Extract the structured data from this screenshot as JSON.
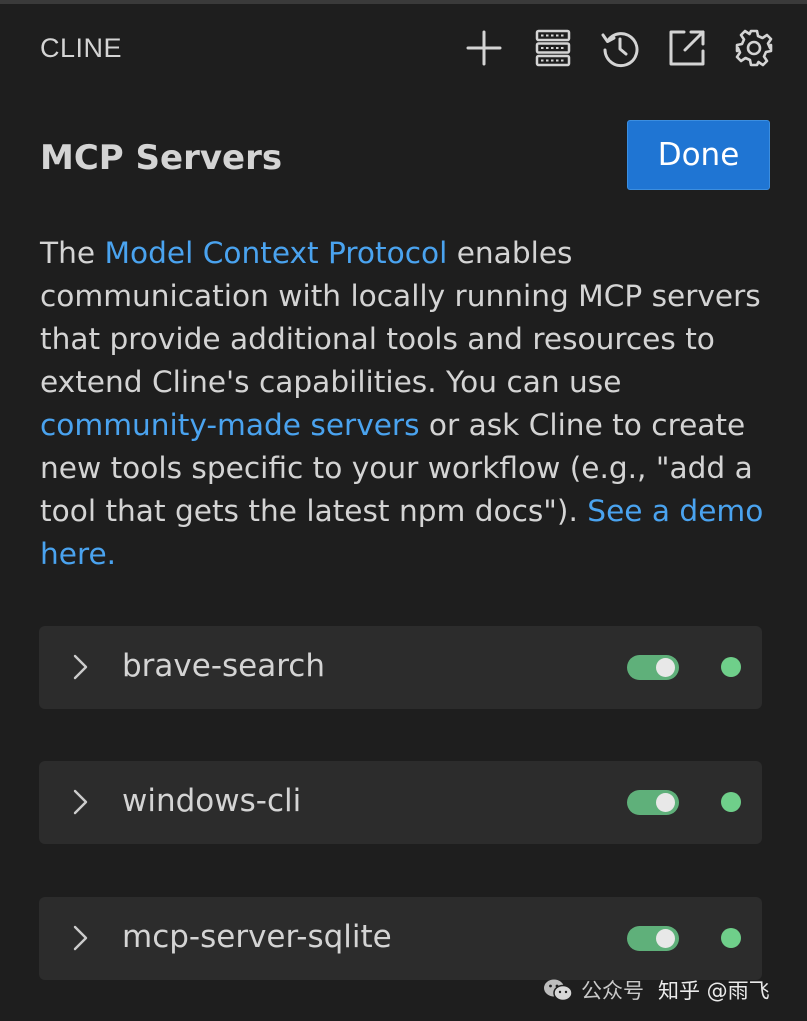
{
  "app": {
    "title": "CLINE"
  },
  "toolbar": {
    "icons": [
      "plus-icon",
      "mcp-servers-icon",
      "history-icon",
      "open-external-icon",
      "gear-icon"
    ]
  },
  "header": {
    "title": "MCP Servers",
    "done_label": "Done"
  },
  "description": {
    "p1": "The ",
    "link1": "Model Context Protocol",
    "p2": " enables communication with locally running MCP servers that provide additional tools and resources to extend Cline's capabilities. You can use ",
    "link2": "community-made servers",
    "p3": " or ask Cline to create new tools specific to your workflow (e.g., \"add a tool that gets the latest npm docs\"). ",
    "link3": "See a demo here."
  },
  "servers": [
    {
      "name": "brave-search",
      "enabled": true,
      "status": "connected"
    },
    {
      "name": "windows-cli",
      "enabled": true,
      "status": "connected"
    },
    {
      "name": "mcp-server-sqlite",
      "enabled": true,
      "status": "connected"
    }
  ],
  "colors": {
    "background": "#1e1e1e",
    "card": "#2c2c2c",
    "accent": "#1f75d3",
    "link": "#4aa3ef",
    "toggle_on": "#5fb07a",
    "status_connected": "#6fcf8a"
  },
  "watermark": {
    "part1": "公众号",
    "part2": "知乎 @雨飞"
  }
}
